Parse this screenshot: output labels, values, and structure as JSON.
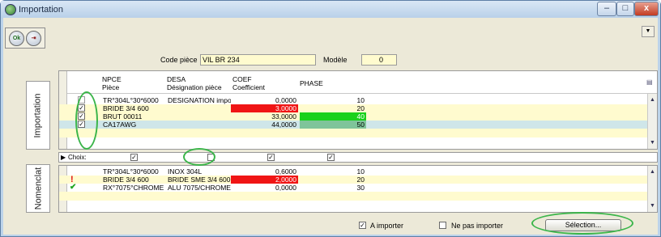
{
  "window": {
    "title": "Importation",
    "minimize": "–",
    "maximize": "□",
    "close": "x"
  },
  "toolbar": {
    "ok_label": "Ok",
    "exit_label": "⇥",
    "menu_arrow": "▼"
  },
  "form": {
    "code_piece_label": "Code pièce",
    "code_piece_value": "VIL BR 234",
    "modele_label": "Modèle",
    "modele_value": "0"
  },
  "tabs": {
    "importation": "Importation",
    "nomenclat": "Nomenclat"
  },
  "import_grid": {
    "columns": [
      {
        "code": "NPCE",
        "label": "Pièce"
      },
      {
        "code": "DESA",
        "label": "Désignation pièce"
      },
      {
        "code": "COEF",
        "label": "Coefficient"
      },
      {
        "code": "PHASE",
        "label": ""
      }
    ],
    "rows": [
      {
        "checked": false,
        "npce": "TR°304L°30*6000",
        "desa": "DESIGNATION impo",
        "coef": "0,0000",
        "phase": "10",
        "coef_color": "#ffffff",
        "phase_color": "#ffffff"
      },
      {
        "checked": true,
        "npce": "BRIDE 3/4  600",
        "desa": "",
        "coef": "3,0000",
        "phase": "20",
        "coef_color": "#f01515",
        "phase_color": "#fffbcf"
      },
      {
        "checked": true,
        "npce": "BRUT 00011",
        "desa": "",
        "coef": "33,0000",
        "phase": "40",
        "coef_color": "#fffbcf",
        "phase_color": "#19d11c"
      },
      {
        "checked": true,
        "npce": "CA17AWG",
        "desa": "",
        "coef": "44,0000",
        "phase": "50",
        "coef_color": "#cfe6e9",
        "phase_color": "#7fc49a"
      }
    ]
  },
  "choix_row": {
    "label": "Choix:",
    "npce": true,
    "desa": false,
    "coef": true,
    "phase": true
  },
  "nomenclat_grid": {
    "rows": [
      {
        "icon": "",
        "npce": "TR°304L°30*6000",
        "desa": "INOX 304L",
        "coef": "0,6000",
        "phase": "10",
        "coef_color": "#ffffff"
      },
      {
        "icon": "!",
        "npce": "BRIDE 3/4  600",
        "desa": "BRIDE SME 3/4 600",
        "coef": "2,0000",
        "phase": "20",
        "coef_color": "#f01515"
      },
      {
        "icon": "✔",
        "npce": "RX°7075°CHROME",
        "desa": "ALU 7075/CHROME",
        "coef": "0,0000",
        "phase": "30",
        "coef_color": "#ffffff"
      }
    ]
  },
  "footer": {
    "a_importer_label": "A importer",
    "a_importer_checked": true,
    "ne_pas_importer_label": "Ne pas importer",
    "ne_pas_importer_checked": false,
    "selection_label": "Sélection..."
  },
  "colors": {
    "highlight": "#3bb54a",
    "input_bg": "#fffbcf",
    "red": "#f01515",
    "green": "#19d11c"
  }
}
